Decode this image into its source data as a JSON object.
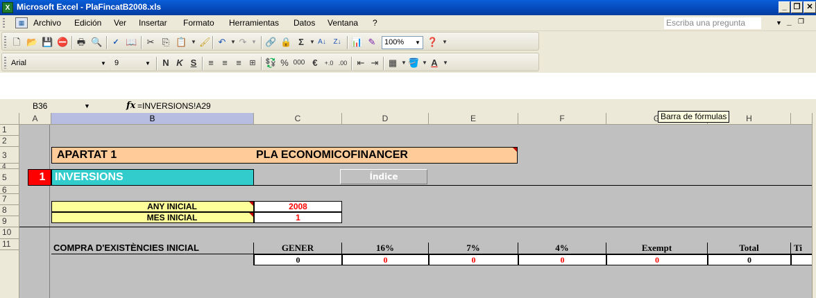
{
  "window": {
    "title": "Microsoft Excel - PlaFincatB2008.xls",
    "app_icon": "X"
  },
  "menu": {
    "items": [
      "Archivo",
      "Edición",
      "Ver",
      "Insertar",
      "Formato",
      "Herramientas",
      "Datos",
      "Ventana",
      "?"
    ],
    "ask_placeholder": "Escriba una pregunta"
  },
  "standard_toolbar": {
    "zoom": "100%"
  },
  "format_toolbar": {
    "font": "Arial",
    "size": "9",
    "bold": "N",
    "italic": "K",
    "underline": "S",
    "percent": "%",
    "thousands": "000",
    "currency": "€"
  },
  "formula_bar": {
    "name_box": "B36",
    "fx": "fx",
    "formula": "=INVERSIONS!A29",
    "tooltip": "Barra de fórmulas"
  },
  "grid": {
    "columns": [
      "A",
      "B",
      "C",
      "D",
      "E",
      "F",
      "G",
      "H"
    ],
    "rows": [
      "1",
      "2",
      "3",
      "4",
      "5",
      "6",
      "7",
      "8",
      "9",
      "10",
      "11"
    ]
  },
  "sheet": {
    "apartat_label": "APARTAT 1",
    "apartat_title": "PLA ECONOMICOFINANCER",
    "section_number": "1",
    "section_title": "INVERSIONS",
    "index_button": "Índice",
    "any_inicial_label": "ANY INICIAL",
    "any_inicial_value": "2008",
    "mes_inicial_label": "MES INICIAL",
    "mes_inicial_value": "1",
    "table": {
      "row_label": "COMPRA D'EXISTÈNCIES INICIAL",
      "headers": [
        "GENER",
        "16%",
        "7%",
        "4%",
        "Exempt",
        "Total",
        "Ti"
      ],
      "values": [
        "0",
        "0",
        "0",
        "0",
        "0",
        "0",
        ""
      ]
    }
  },
  "colors": {
    "apartat_fill": "#ffcc99",
    "section_fill": "#33cccc",
    "section_number_fill": "#ff0000",
    "input_label_fill": "#ffff99",
    "value_red": "#ff0000"
  }
}
